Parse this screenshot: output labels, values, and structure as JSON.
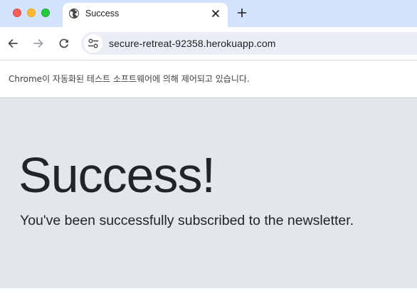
{
  "window": {
    "controls": [
      "close",
      "minimize",
      "zoom"
    ]
  },
  "tab": {
    "title": "Success",
    "favicon": "globe-icon",
    "close_icon": "close-icon"
  },
  "toolbar": {
    "back_icon": "back-arrow-icon",
    "forward_icon": "forward-arrow-icon",
    "reload_icon": "reload-icon",
    "new_tab_icon": "plus-icon",
    "site_info_icon": "tune-icon",
    "url": "secure-retreat-92358.herokuapp.com"
  },
  "infobar": {
    "message": "Chrome이 자동화된 테스트 소프트웨어에 의해 제어되고 있습니다."
  },
  "page": {
    "heading": "Success!",
    "lead": "You've been successfully subscribed to the newsletter."
  },
  "colors": {
    "tabstrip": "#d3e3fd",
    "jumbotron": "#e4e7ea",
    "text": "#212529"
  }
}
